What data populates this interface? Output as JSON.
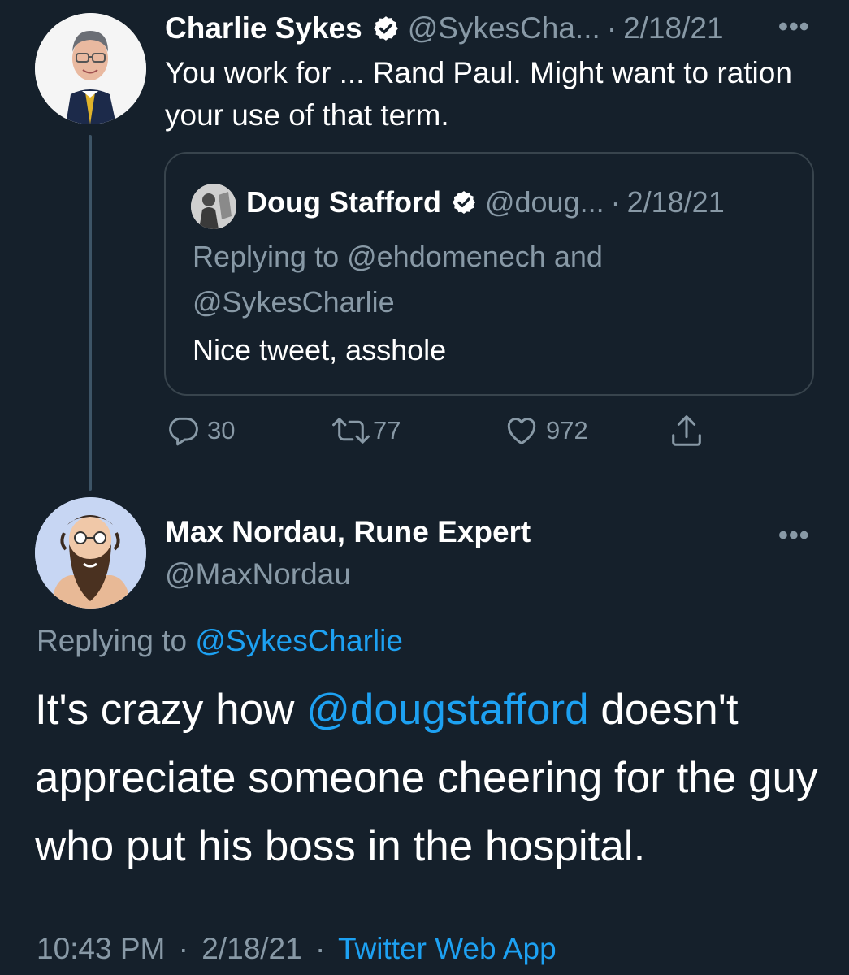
{
  "parent_tweet": {
    "author_name": "Charlie Sykes",
    "handle": "@SykesCha...",
    "separator": "·",
    "date": "2/18/21",
    "text": "You work for ... Rand Paul. Might want to ration your use of that term.",
    "quoted": {
      "author_name": "Doug Stafford",
      "handle": "@doug...",
      "separator": "·",
      "date": "2/18/21",
      "replying_to": "Replying to @ehdomenech and @SykesCharlie",
      "text": "Nice tweet, asshole"
    },
    "actions": {
      "replies": "30",
      "retweets": "77",
      "likes": "972"
    }
  },
  "reply_tweet": {
    "author_name": "Max Nordau, Rune Expert",
    "handle": "@MaxNordau",
    "replying_prefix": "Replying to",
    "replying_handle": "@SykesCharlie",
    "text_before": "It's crazy how ",
    "mention": "@dougstafford",
    "text_after": " doesn't appreciate someone cheering for the guy who put his boss in the hospital.",
    "time": "10:43 PM",
    "separator": "·",
    "date": "2/18/21",
    "separator2": "·",
    "source": "Twitter Web App"
  },
  "colors": {
    "background": "#15202b",
    "primary_text": "#ffffff",
    "secondary_text": "#8899a6",
    "link": "#1da1f2",
    "border": "#38444d"
  },
  "icons": [
    "verified-badge-icon",
    "more-options-icon",
    "reply-icon",
    "retweet-icon",
    "like-icon",
    "share-icon"
  ]
}
